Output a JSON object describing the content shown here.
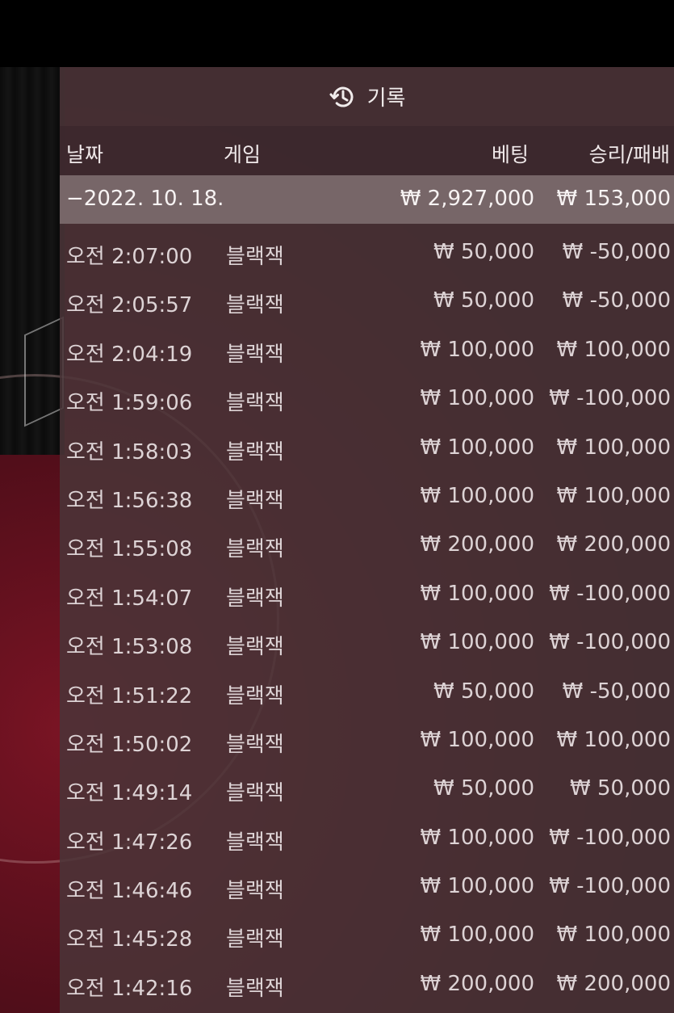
{
  "header": {
    "title": "기록",
    "icon": "history-icon"
  },
  "columns": {
    "date": "날짜",
    "game": "게임",
    "bet": "베팅",
    "winloss": "승리/패배"
  },
  "summary": {
    "date": "−2022. 10. 18.",
    "bet": "₩ 2,927,000",
    "winloss": "₩ 153,000"
  },
  "rows": [
    {
      "time": "오전 2:07:00",
      "game": "블랙잭",
      "bet": "₩ 50,000",
      "winloss": "₩ -50,000"
    },
    {
      "time": "오전 2:05:57",
      "game": "블랙잭",
      "bet": "₩ 50,000",
      "winloss": "₩ -50,000"
    },
    {
      "time": "오전 2:04:19",
      "game": "블랙잭",
      "bet": "₩ 100,000",
      "winloss": "₩ 100,000"
    },
    {
      "time": "오전 1:59:06",
      "game": "블랙잭",
      "bet": "₩ 100,000",
      "winloss": "₩ -100,000"
    },
    {
      "time": "오전 1:58:03",
      "game": "블랙잭",
      "bet": "₩ 100,000",
      "winloss": "₩ 100,000"
    },
    {
      "time": "오전 1:56:38",
      "game": "블랙잭",
      "bet": "₩ 100,000",
      "winloss": "₩ 100,000"
    },
    {
      "time": "오전 1:55:08",
      "game": "블랙잭",
      "bet": "₩ 200,000",
      "winloss": "₩ 200,000"
    },
    {
      "time": "오전 1:54:07",
      "game": "블랙잭",
      "bet": "₩ 100,000",
      "winloss": "₩ -100,000"
    },
    {
      "time": "오전 1:53:08",
      "game": "블랙잭",
      "bet": "₩ 100,000",
      "winloss": "₩ -100,000"
    },
    {
      "time": "오전 1:51:22",
      "game": "블랙잭",
      "bet": "₩ 50,000",
      "winloss": "₩ -50,000"
    },
    {
      "time": "오전 1:50:02",
      "game": "블랙잭",
      "bet": "₩ 100,000",
      "winloss": "₩ 100,000"
    },
    {
      "time": "오전 1:49:14",
      "game": "블랙잭",
      "bet": "₩ 50,000",
      "winloss": "₩ 50,000"
    },
    {
      "time": "오전 1:47:26",
      "game": "블랙잭",
      "bet": "₩ 100,000",
      "winloss": "₩ -100,000"
    },
    {
      "time": "오전 1:46:46",
      "game": "블랙잭",
      "bet": "₩ 100,000",
      "winloss": "₩ -100,000"
    },
    {
      "time": "오전 1:45:28",
      "game": "블랙잭",
      "bet": "₩ 100,000",
      "winloss": "₩ 100,000"
    },
    {
      "time": "오전 1:42:16",
      "game": "블랙잭",
      "bet": "₩ 200,000",
      "winloss": "₩ 200,000"
    }
  ]
}
